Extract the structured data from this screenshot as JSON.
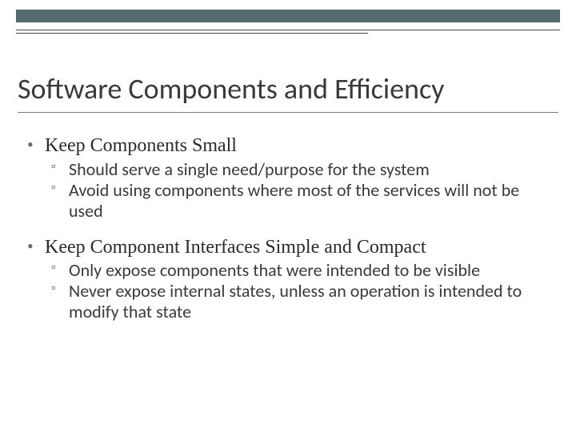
{
  "title": "Software Components and Efficiency",
  "bullets": [
    {
      "text": "Keep Components Small",
      "sub": [
        "Should serve a single need/purpose for the system",
        "Avoid using components where most of the services will not be used"
      ]
    },
    {
      "text": "Keep Component Interfaces Simple and Compact",
      "sub": [
        "Only expose components that were intended to be visible",
        "Never expose internal states, unless an operation is intended to modify that state"
      ]
    }
  ]
}
